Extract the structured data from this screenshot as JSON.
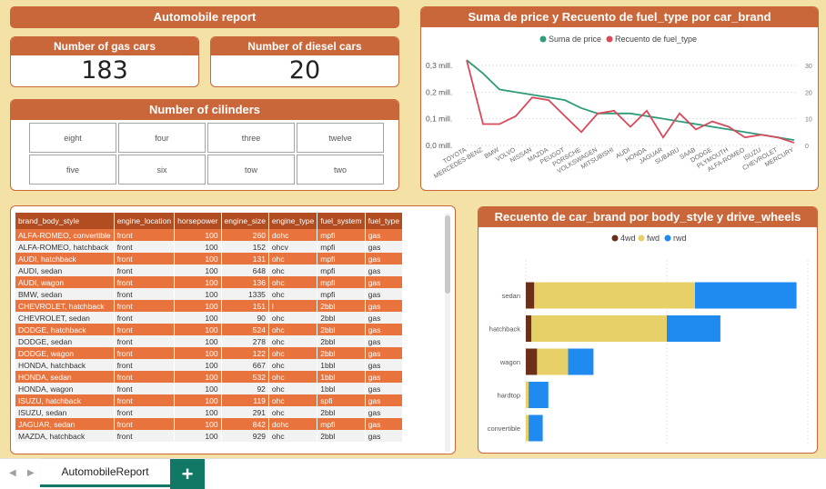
{
  "report": {
    "title": "Automobile report",
    "gas_card": {
      "label": "Number of gas cars",
      "value": "183"
    },
    "diesel_card": {
      "label": "Number of diesel cars",
      "value": "20"
    },
    "cylinders": {
      "title": "Number of cilinders",
      "options": [
        "eight",
        "four",
        "three",
        "twelve",
        "five",
        "six",
        "tow",
        "two"
      ]
    }
  },
  "tabs": {
    "active": "AutomobileReport",
    "add_label": "+"
  },
  "table": {
    "columns": [
      "brand_body_style",
      "engine_location",
      "horsepower",
      "engine_size",
      "engine_type",
      "fuel_system",
      "fuel_type"
    ],
    "rows": [
      [
        "ALFA-ROMEO, convertible",
        "front",
        "100",
        "260",
        "dohc",
        "mpfi",
        "gas"
      ],
      [
        "ALFA-ROMEO, hatchback",
        "front",
        "100",
        "152",
        "ohcv",
        "mpfi",
        "gas"
      ],
      [
        "AUDI, hatchback",
        "front",
        "100",
        "131",
        "ohc",
        "mpfi",
        "gas"
      ],
      [
        "AUDI, sedan",
        "front",
        "100",
        "648",
        "ohc",
        "mpfi",
        "gas"
      ],
      [
        "AUDI, wagon",
        "front",
        "100",
        "136",
        "ohc",
        "mpfi",
        "gas"
      ],
      [
        "BMW, sedan",
        "front",
        "100",
        "1335",
        "ohc",
        "mpfi",
        "gas"
      ],
      [
        "CHEVROLET, hatchback",
        "front",
        "100",
        "151",
        "l",
        "2bbl",
        "gas"
      ],
      [
        "CHEVROLET, sedan",
        "front",
        "100",
        "90",
        "ohc",
        "2bbl",
        "gas"
      ],
      [
        "DODGE, hatchback",
        "front",
        "100",
        "524",
        "ohc",
        "2bbl",
        "gas"
      ],
      [
        "DODGE, sedan",
        "front",
        "100",
        "278",
        "ohc",
        "2bbl",
        "gas"
      ],
      [
        "DODGE, wagon",
        "front",
        "100",
        "122",
        "ohc",
        "2bbl",
        "gas"
      ],
      [
        "HONDA, hatchback",
        "front",
        "100",
        "667",
        "ohc",
        "1bbl",
        "gas"
      ],
      [
        "HONDA, sedan",
        "front",
        "100",
        "532",
        "ohc",
        "1bbl",
        "gas"
      ],
      [
        "HONDA, wagon",
        "front",
        "100",
        "92",
        "ohc",
        "1bbl",
        "gas"
      ],
      [
        "ISUZU, hatchback",
        "front",
        "100",
        "119",
        "ohc",
        "spfi",
        "gas"
      ],
      [
        "ISUZU, sedan",
        "front",
        "100",
        "291",
        "ohc",
        "2bbl",
        "gas"
      ],
      [
        "JAGUAR, sedan",
        "front",
        "100",
        "842",
        "dohc",
        "mpfi",
        "gas"
      ],
      [
        "MAZDA, hatchback",
        "front",
        "100",
        "929",
        "ohc",
        "2bbl",
        "gas"
      ]
    ]
  },
  "colors": {
    "accent": "#c9673a",
    "row_odd": "#e9733d",
    "row_even": "#f2f2f2",
    "background": "#f3e1a6",
    "tab_green": "#117865"
  },
  "chart_data": [
    {
      "type": "line",
      "title": "Suma de price y Recuento de fuel_type por car_brand",
      "categories": [
        "TOYOTA",
        "MERCEDES-BENZ",
        "BMW",
        "VOLVO",
        "NISSAN",
        "MAZDA",
        "PEUGOT",
        "PORSCHE",
        "VOLKSWAGEN",
        "MITSUBISHI",
        "AUDI",
        "HONDA",
        "JAGUAR",
        "SUBARU",
        "SAAB",
        "DODGE",
        "PLYMOUTH",
        "ALFA-ROMEO",
        "ISUZU",
        "CHEVROLET",
        "MERCURY"
      ],
      "series": [
        {
          "name": "Suma de price",
          "axis": "left",
          "color": "#2e9c7a",
          "values": [
            0.32,
            0.27,
            0.21,
            0.2,
            0.19,
            0.18,
            0.17,
            0.14,
            0.12,
            0.12,
            0.12,
            0.11,
            0.1,
            0.09,
            0.08,
            0.07,
            0.06,
            0.05,
            0.04,
            0.03,
            0.02
          ]
        },
        {
          "name": "Recuento de fuel_type",
          "axis": "right",
          "color": "#d9495b",
          "values": [
            32,
            8,
            8,
            11,
            18,
            17,
            11,
            5,
            12,
            13,
            7,
            13,
            3,
            12,
            6,
            9,
            7,
            3,
            4,
            3,
            1
          ]
        }
      ],
      "y_left": {
        "ticks": [
          "0,0 mill.",
          "0,1 mill.",
          "0,2 mill.",
          "0,3 mill."
        ],
        "range": [
          0,
          0.3
        ]
      },
      "y_right": {
        "ticks": [
          "0",
          "10",
          "20",
          "30"
        ],
        "range": [
          0,
          30
        ]
      },
      "legend": "top-center"
    },
    {
      "type": "bar",
      "orientation": "horizontal",
      "stacked": true,
      "title": "Recuento de car_brand por body_style y drive_wheels",
      "categories": [
        "sedan",
        "hatchback",
        "wagon",
        "hardtop",
        "convertible"
      ],
      "series": [
        {
          "name": "4wd",
          "color": "#6b2f1a",
          "values": [
            3,
            2,
            4,
            0,
            0
          ]
        },
        {
          "name": "fwd",
          "color": "#e8d068",
          "values": [
            57,
            48,
            11,
            1,
            1
          ]
        },
        {
          "name": "rwd",
          "color": "#1f8bf0",
          "values": [
            36,
            19,
            9,
            7,
            5
          ]
        }
      ],
      "x_ticks": [
        "0",
        "50",
        "100"
      ],
      "xlim": [
        0,
        100
      ],
      "legend": "top-center"
    }
  ]
}
